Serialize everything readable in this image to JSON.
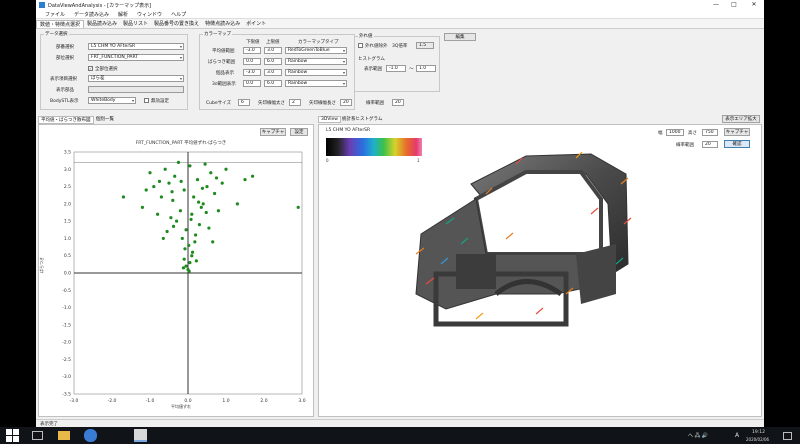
{
  "window": {
    "title": "DataViewAndAnalysis - [カラーマップ表示]",
    "min": "—",
    "max": "□",
    "close": "✕"
  },
  "menu": [
    "ファイル",
    "データ読み込み",
    "解析",
    "ウィンドウ",
    "ヘルプ"
  ],
  "ribbon_tabs": [
    "数値・特徴点選択",
    "製品読み込み",
    "製品リスト",
    "製品番号の置き換え",
    "特徴点読み込み",
    "ポイント"
  ],
  "data_select": {
    "group_title": "データ選択",
    "vehicle_label": "部番選択",
    "vehicle_value": "L5 CHM YO AFterSR",
    "part_label": "部位選択",
    "part_value": "FRT_FUNCTION_PART",
    "all_parts_label": "全部位選択",
    "display_label": "表示項目選択",
    "display_value": "ばら差",
    "display_part_label": "表示部品",
    "body_stl_label": "BodySTL表示",
    "body_stl_value": "WhiteBody",
    "disable_label": "無効設定"
  },
  "colormap": {
    "group_title": "カラーマップ",
    "lower_header": "下限値",
    "upper_header": "上限値",
    "type_header": "カラーマップタイプ",
    "rows": [
      {
        "label": "平均値範囲",
        "lower": "-3.0",
        "upper": "3.0",
        "type": "RedToGreenToBlue"
      },
      {
        "label": "ばらつき範囲",
        "lower": "0.0",
        "upper": "6.0",
        "type": "Rainbow"
      },
      {
        "label": "個品表示",
        "lower": "-3.0",
        "upper": "3.0",
        "type": "Rainbow"
      },
      {
        "label": "3σ範囲表示",
        "lower": "0.0",
        "upper": "6.0",
        "type": "Rainbow"
      }
    ],
    "cube_size_label": "Cubeサイズ",
    "cube_size": "6",
    "arrow_line_label": "矢印線幅太さ",
    "arrow_line": "2",
    "arrow_len_label": "矢印線幅長さ",
    "arrow_len": "20",
    "scale_label": "線率範囲",
    "scale": "20"
  },
  "outer_limits": {
    "group_title": "外れ値",
    "outlier_label": "外れ値除外",
    "sigma_label": "3Q倍率",
    "sigma_value": "1.5",
    "hist_title": "ヒストグラム",
    "disp_range_label": "表示範囲",
    "range_min": "-1.0",
    "range_sep": "～",
    "range_max": "1.0"
  },
  "edit_button": "編集",
  "left_panel": {
    "tab_label": "平均値・ばらつき散布図",
    "tab2_label": "個別一覧",
    "copy_button": "キャプチャ",
    "settings_button": "設定",
    "plot_title": "FRT_FUNCTION_PART 平均値ずれ-ばらつき",
    "xlabel": "平均値ずれ",
    "ylabel": "ばらつき"
  },
  "right_panel": {
    "tab_label": "3DView",
    "tab2_label": "統計系ヒストグラム",
    "expand_button": "表示エリア拡大",
    "vehicle_tag": "L5 CHM YO AFterSR",
    "width_label": "幅",
    "width_value": "1000",
    "height_label": "高さ",
    "height_value": "750",
    "capture_button": "キャプチャ",
    "zoom_label": "線率範囲",
    "zoom_value": "20",
    "apply_button": "確認",
    "colorbar_min": "0",
    "colorbar_max": "1"
  },
  "status": "表示完了",
  "taskbar": {
    "time": "19:12",
    "date": "2020/02/06",
    "ime": "A",
    "tray": "へ 🖧 🔊"
  },
  "chart_data": {
    "type": "scatter",
    "title": "FRT_FUNCTION_PART 平均値ずれ-ばらつき",
    "xlabel": "平均値ずれ",
    "ylabel": "ばらつき",
    "xlim": [
      -3.0,
      3.0
    ],
    "ylim": [
      -3.5,
      3.5
    ],
    "xticks": [
      "-3.0",
      "-2.0",
      "-1.0",
      "0.0",
      "1.0",
      "2.0",
      "3.0"
    ],
    "yticks": [
      "3.5",
      "3.0",
      "2.5",
      "2.0",
      "1.5",
      "1.0",
      "0.5",
      "0.0",
      "-0.5",
      "-1.0",
      "-1.5",
      "-2.0",
      "-2.5",
      "-3.0",
      "-3.5"
    ],
    "color": "#1f8a1f",
    "points": [
      [
        0.0,
        0.1
      ],
      [
        0.05,
        0.3
      ],
      [
        -0.05,
        0.2
      ],
      [
        0.1,
        0.5
      ],
      [
        -0.1,
        0.4
      ],
      [
        0.02,
        0.8
      ],
      [
        -0.15,
        1.0
      ],
      [
        0.2,
        1.1
      ],
      [
        0.3,
        1.4
      ],
      [
        -0.3,
        1.5
      ],
      [
        0.1,
        1.7
      ],
      [
        -0.2,
        1.8
      ],
      [
        0.4,
        2.0
      ],
      [
        -0.4,
        2.1
      ],
      [
        0.15,
        2.2
      ],
      [
        -0.1,
        2.4
      ],
      [
        0.5,
        2.5
      ],
      [
        -0.5,
        2.6
      ],
      [
        0.25,
        2.7
      ],
      [
        -0.35,
        2.8
      ],
      [
        0.6,
        2.9
      ],
      [
        -0.6,
        3.0
      ],
      [
        0.05,
        3.1
      ],
      [
        0.45,
        3.15
      ],
      [
        -0.25,
        3.2
      ],
      [
        0.7,
        2.3
      ],
      [
        -0.7,
        2.2
      ],
      [
        0.35,
        1.9
      ],
      [
        -0.45,
        1.6
      ],
      [
        0.55,
        1.3
      ],
      [
        -0.55,
        1.2
      ],
      [
        0.8,
        1.8
      ],
      [
        -0.8,
        1.7
      ],
      [
        0.9,
        2.6
      ],
      [
        -0.9,
        2.5
      ],
      [
        1.0,
        3.0
      ],
      [
        -1.0,
        2.9
      ],
      [
        0.12,
        0.6
      ],
      [
        -0.08,
        0.7
      ],
      [
        0.18,
        0.9
      ],
      [
        1.3,
        2.0
      ],
      [
        -1.2,
        1.9
      ],
      [
        1.5,
        2.7
      ],
      [
        -1.1,
        2.4
      ],
      [
        0.65,
        0.9
      ],
      [
        -0.65,
        1.0
      ],
      [
        2.9,
        1.9
      ],
      [
        -1.7,
        2.2
      ],
      [
        1.7,
        2.8
      ],
      [
        0.28,
        2.05
      ],
      [
        -0.18,
        2.65
      ],
      [
        0.38,
        2.45
      ],
      [
        -0.42,
        2.35
      ],
      [
        0.08,
        1.55
      ],
      [
        -0.05,
        1.25
      ],
      [
        0.22,
        0.35
      ],
      [
        -0.12,
        0.15
      ],
      [
        0.03,
        0.05
      ],
      [
        0.48,
        1.75
      ],
      [
        -0.38,
        1.35
      ],
      [
        0.75,
        2.75
      ],
      [
        -0.75,
        2.65
      ]
    ]
  }
}
